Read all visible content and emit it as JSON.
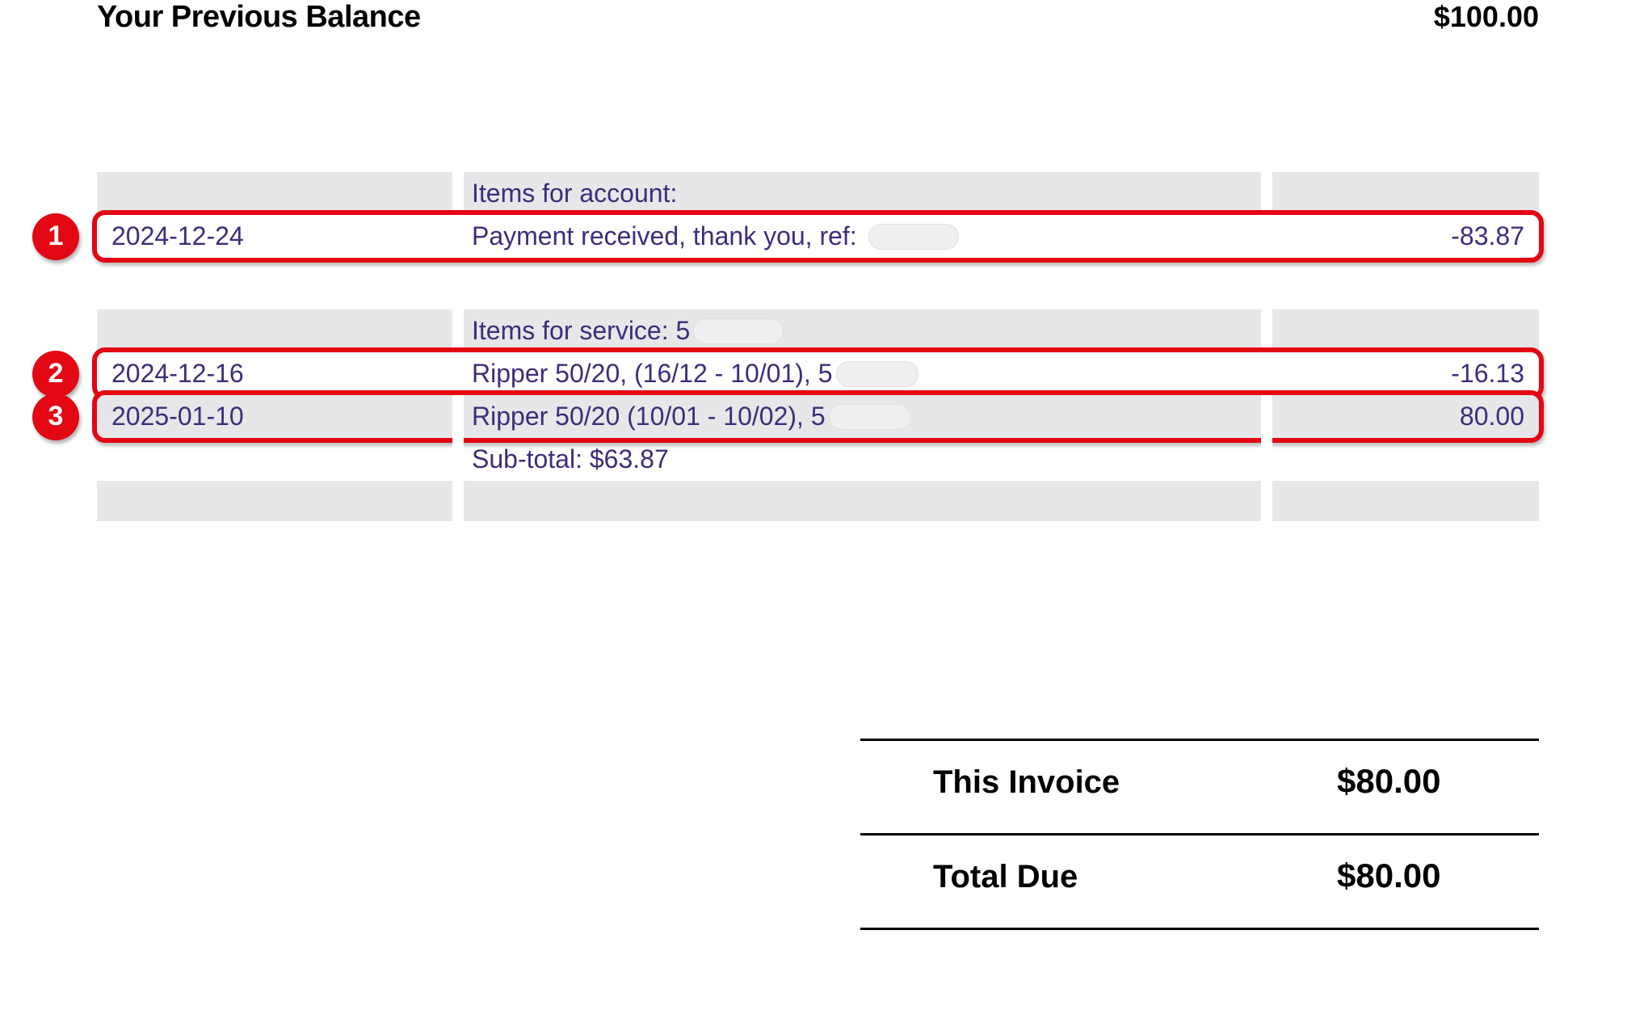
{
  "header": {
    "previous_balance_label": "Your Previous Balance",
    "previous_balance_amount": "$100.00"
  },
  "annotations": [
    {
      "n": "1"
    },
    {
      "n": "2"
    },
    {
      "n": "3"
    }
  ],
  "sections": {
    "account": {
      "heading": "Items for account:",
      "rows": [
        {
          "date": "2024-12-24",
          "desc": "Payment received, thank you, ref:",
          "amount": "-83.87"
        }
      ]
    },
    "service": {
      "heading_prefix": "Items for service: 5",
      "rows": [
        {
          "date": "2024-12-16",
          "desc_prefix": "Ripper 50/20, (16/12 - 10/01), 5",
          "amount": "-16.13"
        },
        {
          "date": "2025-01-10",
          "desc_prefix": "Ripper 50/20 (10/01 - 10/02), 5",
          "amount": "80.00"
        }
      ],
      "subtotal": "Sub-total: $63.87"
    }
  },
  "totals": {
    "this_invoice_label": "This Invoice",
    "this_invoice_amount": "$80.00",
    "total_due_label": "Total Due",
    "total_due_amount": "$80.00"
  }
}
